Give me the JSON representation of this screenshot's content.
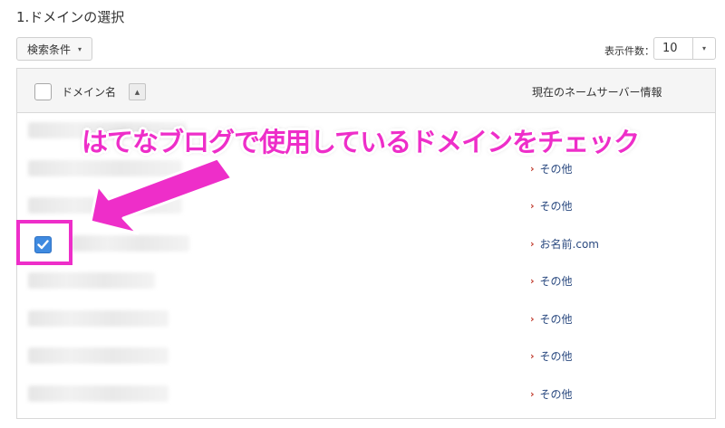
{
  "section_title": "1.ドメインの選択",
  "search": {
    "label": "検索条件",
    "caret": "▾"
  },
  "count": {
    "label": "表示件数：",
    "value": "10",
    "caret": "▾"
  },
  "table": {
    "col_domain": "ドメイン名",
    "sort_glyph": "▲",
    "col_nameserver": "現在のネームサーバー情報",
    "rows": [
      {
        "checked": false,
        "nameserver": ""
      },
      {
        "checked": false,
        "nameserver": "その他"
      },
      {
        "checked": false,
        "nameserver": "その他"
      },
      {
        "checked": true,
        "nameserver": "お名前.com"
      },
      {
        "checked": false,
        "nameserver": "その他"
      },
      {
        "checked": false,
        "nameserver": "その他"
      },
      {
        "checked": false,
        "nameserver": "その他"
      },
      {
        "checked": false,
        "nameserver": "その他"
      }
    ]
  },
  "annotation": {
    "text": "はてなブログで使用しているドメインをチェック",
    "color": "#ee2ec9"
  },
  "colors": {
    "link": "#2b4a80",
    "chevron": "#c0392b",
    "checkbox": "#3f8ae0"
  }
}
